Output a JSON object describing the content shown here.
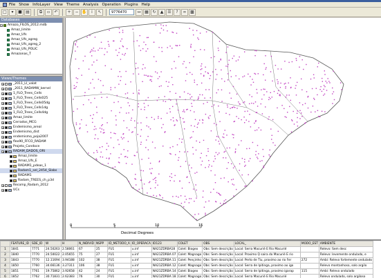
{
  "window": {
    "accent": "#3c5f9e"
  },
  "menu": [
    "File",
    "Show",
    "InfoLayer",
    "View",
    "Theme",
    "Analysis",
    "Operation",
    "Plugins",
    "Help"
  ],
  "toolbar": {
    "scale_value": "9776470",
    "icons": [
      "new-icon",
      "open-icon",
      "save-icon",
      "print-icon",
      "copy-icon",
      "paste-icon",
      "undo-icon",
      "zoom-in-icon",
      "zoom-out-icon",
      "pan-icon",
      "info-icon",
      "select-icon",
      "measure-icon",
      "grid-icon",
      "refresh-icon"
    ]
  },
  "databases": {
    "header": "Databases",
    "root": "Amazo_FILOS_2012.mdb",
    "items": [
      "Amaz_limite",
      "Amaz_Ufs",
      "Amaz_Ufs_agreg",
      "Amaz_Ufs_agreg_2",
      "Amaz_Ufs_POLIC",
      "Amazonas_T"
    ]
  },
  "views": {
    "header": "Views/Themes",
    "items": [
      {
        "label": "_2011_LI_valat",
        "level": 0,
        "checked": false
      },
      {
        "label": "_2011_RADAMW_kernel",
        "level": 0,
        "checked": false
      },
      {
        "label": "1_FLO_Trees_Cells",
        "level": 0,
        "checked": true
      },
      {
        "label": "1_FLO_Trees_Cells025",
        "level": 0,
        "checked": true
      },
      {
        "label": "1_FLO_Trees_Cells05dg",
        "level": 0,
        "checked": true
      },
      {
        "label": "1_FLO_Trees_Cells1dg",
        "level": 0,
        "checked": true
      },
      {
        "label": "1_FLO_Trees_Cells4dg",
        "level": 0,
        "checked": true
      },
      {
        "label": "Amaz_limite",
        "level": 0,
        "checked": true
      },
      {
        "label": "Cerrados_MCG",
        "level": 0,
        "checked": true
      },
      {
        "label": "Endemismo_areal",
        "level": 0,
        "checked": true
      },
      {
        "label": "Endemismo_dist",
        "level": 0,
        "checked": true
      },
      {
        "label": "endemismo_poja2007",
        "level": 0,
        "checked": true
      },
      {
        "label": "flex90_FFCO_RADAM",
        "level": 0,
        "checked": true
      },
      {
        "label": "Projeto_Condoce",
        "level": 0,
        "checked": true
      },
      {
        "label": "RADAM_DADOS_ORI",
        "level": 0,
        "checked": true,
        "selected": true
      },
      {
        "label": "Amaz_limite",
        "level": 1,
        "checked": true
      },
      {
        "label": "Amaz_Ufs_E",
        "level": 1,
        "checked": true
      },
      {
        "label": "RADAM1_pdeas_1",
        "level": 1,
        "checked": true
      },
      {
        "label": "Radam1_sel_2454_Slabs",
        "level": 1,
        "checked": true,
        "selected": true
      },
      {
        "label": "RADAM1",
        "level": 1,
        "checked": true
      },
      {
        "label": "Radam_TREES_ch_p3d",
        "level": 1,
        "checked": true
      },
      {
        "label": "Recomp_Radam_2012",
        "level": 0,
        "checked": false
      },
      {
        "label": "UCs",
        "level": 0,
        "checked": true
      }
    ]
  },
  "map": {
    "scale_label": "Decimal Degrees",
    "ticks": [
      "0",
      "5",
      "10",
      "15"
    ],
    "point_color": "#c040c0",
    "boundary_color": "#555555"
  },
  "table": {
    "columns": [
      "",
      "FEATURE_ID",
      "SDE_ID",
      "W",
      "H",
      "N_INDIVID",
      "NSPP",
      "ID_METODO_A",
      "ID_OPERACA",
      "ID123",
      "COLET",
      "OBS",
      "LOCAL_",
      "MODO_EST",
      "AMBIENTE"
    ],
    "rows": [
      [
        "1",
        "1841",
        "7771",
        "24.50263",
        "2.58061",
        "67",
        "25",
        "FU1",
        "u.inf",
        "NA21ZDRBA18",
        "Colet: Biogeo",
        "Obs: Sem descrição",
        "Local: Serra Macurié E Rio Macurié",
        "",
        "Relevo: Sem desc"
      ],
      [
        "2",
        "1840",
        "7770",
        "24.50022",
        "2.05655",
        "75",
        "27",
        "FU1",
        "u.inf",
        "NA21ZDRBA 07",
        "Colet: Magnago",
        "Obs: Sem descrição",
        "Local: Proximo Q saira do Macurié E rio",
        "",
        "Relevo: levemente ondulado, e"
      ],
      [
        "3",
        "1843",
        "7770",
        "12.11694",
        "3.94188",
        "102",
        "38",
        "FU1",
        "u.inf",
        "NA21ZDRBA 11",
        "Colet: Pençinho",
        "Obs: Sem descrição",
        "Local: Perto de Tiu, proximo ao rio Fer",
        "272",
        "Ambi: Relevo fortemente ondulado"
      ],
      [
        "4",
        "1850",
        "7760",
        "34.66136",
        "3.27311",
        "106",
        "38",
        "FU1",
        "u.inf",
        "NA21ZDRBA 12",
        "Colet: Magnago",
        "Obs: Sem descrição",
        "Local: Serra de Ipitinga, proximo ao igo",
        "",
        "Relevo montanhoso, solo argilo"
      ],
      [
        "5",
        "1851",
        "7761",
        "19.75862",
        "3.92658",
        "42",
        "24",
        "FU1",
        "u.inf",
        "NA21ZDRBA 14",
        "Colet: Biogeo",
        "Obs: Sem descrição",
        "Local: Serra de Ipitinga, proximo igarap",
        "115",
        "Ambi: Relevo ondulado"
      ],
      [
        "6",
        "1852",
        "7762",
        "30.71831",
        "2.62383",
        "76",
        "30",
        "FU1",
        "u.inf",
        "NA21ZDRBA 18",
        "Colet: Magnago",
        "Obs: Sem descrição",
        "Local: Serra Macurié E Rio Macurié",
        "",
        "Relevo ondulado, solo argiloso"
      ]
    ]
  }
}
